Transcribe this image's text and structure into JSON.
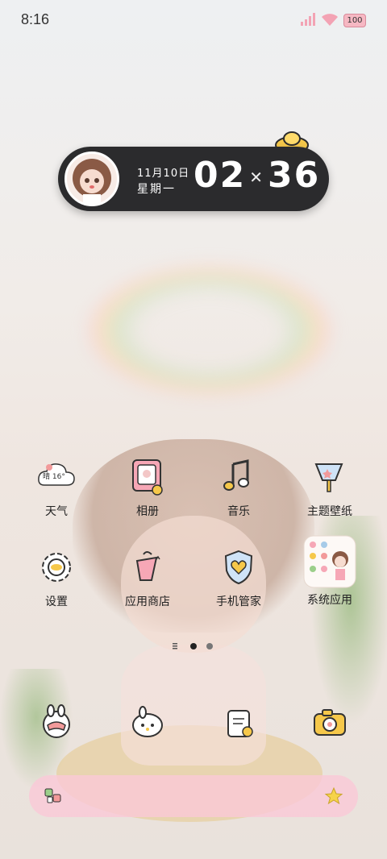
{
  "status_bar": {
    "time": "8:16",
    "battery": "100"
  },
  "clock_widget": {
    "date": "11月10日",
    "weekday": "星期一",
    "hour": "02",
    "minute": "36"
  },
  "apps_row1": [
    {
      "label": "天气",
      "weather_text": "晴 16°"
    },
    {
      "label": "相册"
    },
    {
      "label": "音乐"
    },
    {
      "label": "主题壁纸"
    }
  ],
  "apps_row2": [
    {
      "label": "设置"
    },
    {
      "label": "应用商店"
    },
    {
      "label": "手机管家"
    },
    {
      "label": "系统应用"
    }
  ]
}
